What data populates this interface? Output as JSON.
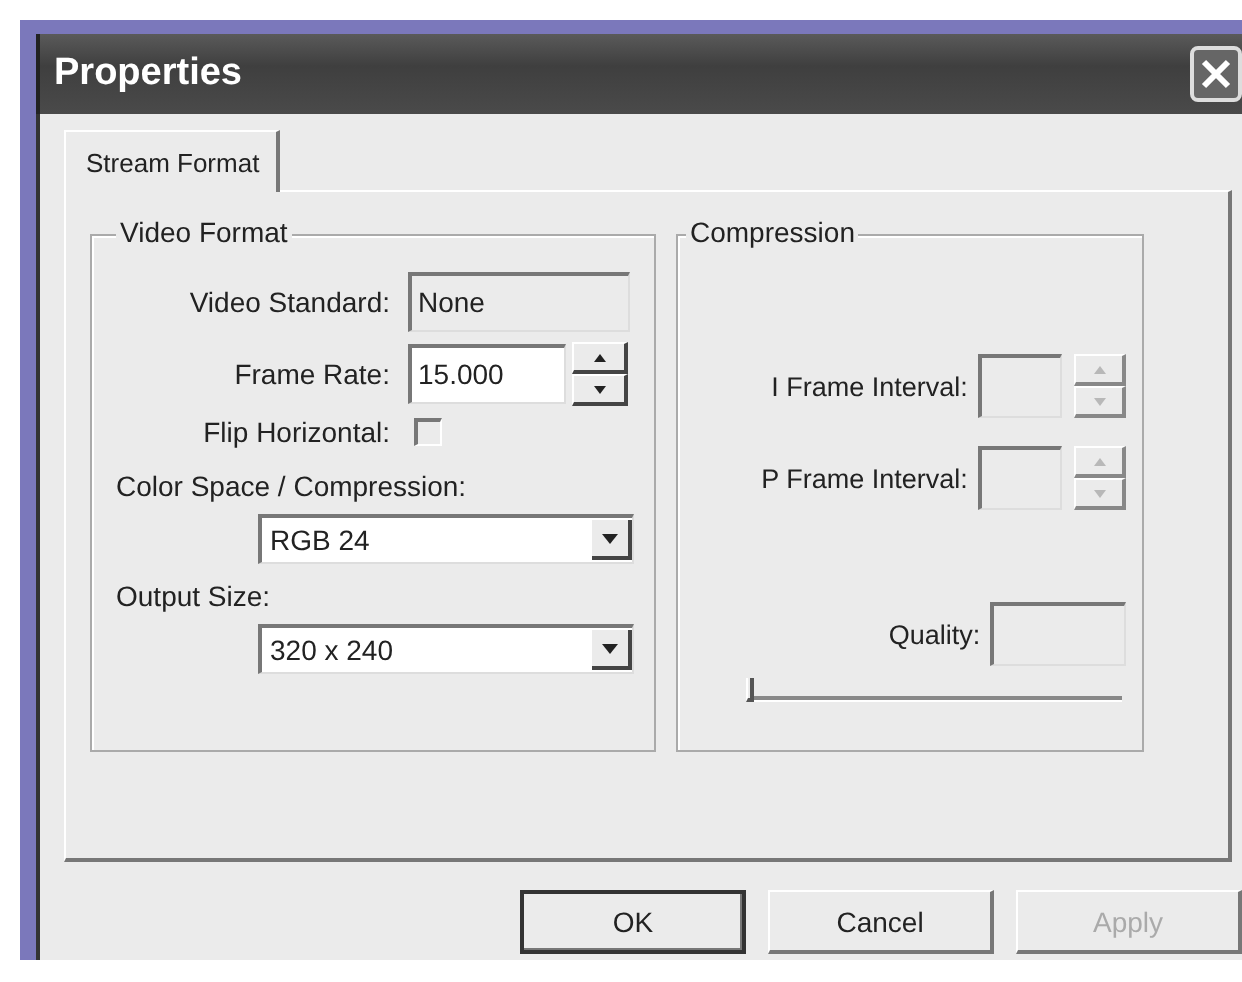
{
  "window": {
    "title": "Properties"
  },
  "tabs": [
    {
      "label": "Stream Format",
      "selected": true
    }
  ],
  "video_format": {
    "title": "Video Format",
    "video_standard": {
      "label": "Video Standard:",
      "value": "None",
      "disabled": true
    },
    "frame_rate": {
      "label": "Frame Rate:",
      "value": "15.000"
    },
    "flip_horizontal": {
      "label": "Flip Horizontal:",
      "checked": false
    },
    "color_space": {
      "label": "Color Space / Compression:",
      "value": "RGB 24"
    },
    "output_size": {
      "label": "Output Size:",
      "value": "320 x 240"
    }
  },
  "compression": {
    "title": "Compression",
    "i_frame_interval": {
      "label": "I Frame Interval:",
      "disabled": true
    },
    "p_frame_interval": {
      "label": "P Frame Interval:",
      "disabled": true
    },
    "quality": {
      "label": "Quality:",
      "disabled": true,
      "level": 0
    }
  },
  "buttons": [
    {
      "label": "OK",
      "default": true,
      "disabled": false
    },
    {
      "label": "Cancel",
      "default": false,
      "disabled": false
    },
    {
      "label": "Apply",
      "default": false,
      "disabled": true
    }
  ]
}
